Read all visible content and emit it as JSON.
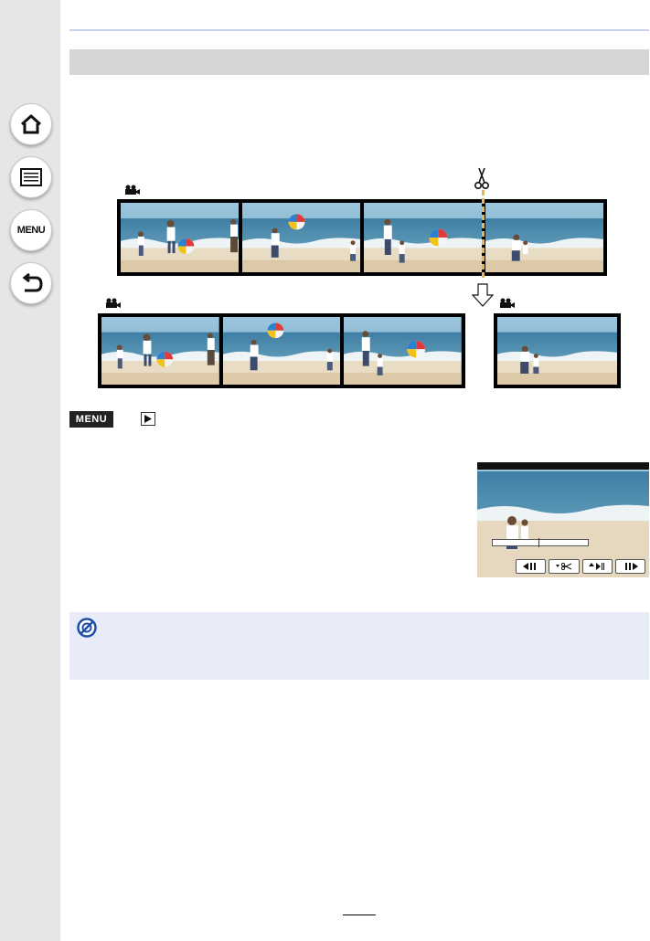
{
  "sidebar": {
    "buttons": [
      {
        "name": "home",
        "icon": "home-icon"
      },
      {
        "name": "contents",
        "icon": "list-icon"
      },
      {
        "name": "menu",
        "icon": "menu-text-icon",
        "label": "MENU"
      },
      {
        "name": "back",
        "icon": "return-arrow-icon"
      }
    ]
  },
  "section": {
    "title": ""
  },
  "diagram": {
    "icons": [
      "scissors-icon",
      "movie-camera-icon",
      "down-arrow-icon"
    ]
  },
  "instruction": {
    "menu_badge": "MENU",
    "icon": "playback-icon"
  },
  "preview": {
    "controls": [
      "step-back-icon",
      "cut-icon",
      "play-pause-icon",
      "step-forward-icon"
    ]
  },
  "note": {
    "icon": "no-entry-icon"
  },
  "colors": {
    "sidebar": "#e6e6e6",
    "section_bar": "#d6d6d6",
    "note_bg": "#e8ecf8",
    "accent": "#1f4fa8",
    "cut_line": "#e8b84a"
  }
}
